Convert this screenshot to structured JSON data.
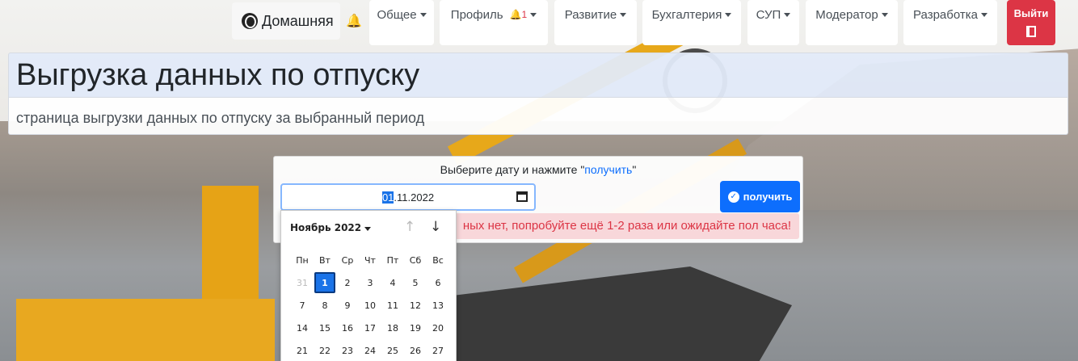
{
  "nav": {
    "home_label": "Домашняя",
    "items": [
      {
        "label": "Общее"
      },
      {
        "label": "Профиль",
        "badge": "1"
      },
      {
        "label": "Развитие"
      },
      {
        "label": "Бухгалтерия"
      },
      {
        "label": "СУП"
      },
      {
        "label": "Модератор"
      },
      {
        "label": "Разработка"
      }
    ],
    "logout_label": "Выйти"
  },
  "header": {
    "title": "Выгрузка данных по отпуску",
    "subtitle": "страница выгрузки данных по отпуску за выбранный период"
  },
  "form": {
    "hint_prefix": "Выберите дату и нажмите \"",
    "hint_link": "получить",
    "hint_suffix": "\"",
    "date_day": "01",
    "date_rest": ".11.2022",
    "button_label": "получить",
    "alert_text": "ных нет, попробуйте ещё 1-2 раза или ожидайте пол часа!"
  },
  "calendar": {
    "month_label": "Ноябрь 2022",
    "weekdays": [
      "Пн",
      "Вт",
      "Ср",
      "Чт",
      "Пт",
      "Сб",
      "Вс"
    ],
    "days": [
      "31",
      "1",
      "2",
      "3",
      "4",
      "5",
      "6",
      "7",
      "8",
      "9",
      "10",
      "11",
      "12",
      "13",
      "14",
      "15",
      "16",
      "17",
      "18",
      "19",
      "20",
      "21",
      "22",
      "23",
      "24",
      "25",
      "26",
      "27"
    ],
    "selected": "1",
    "muted": [
      "31"
    ]
  }
}
